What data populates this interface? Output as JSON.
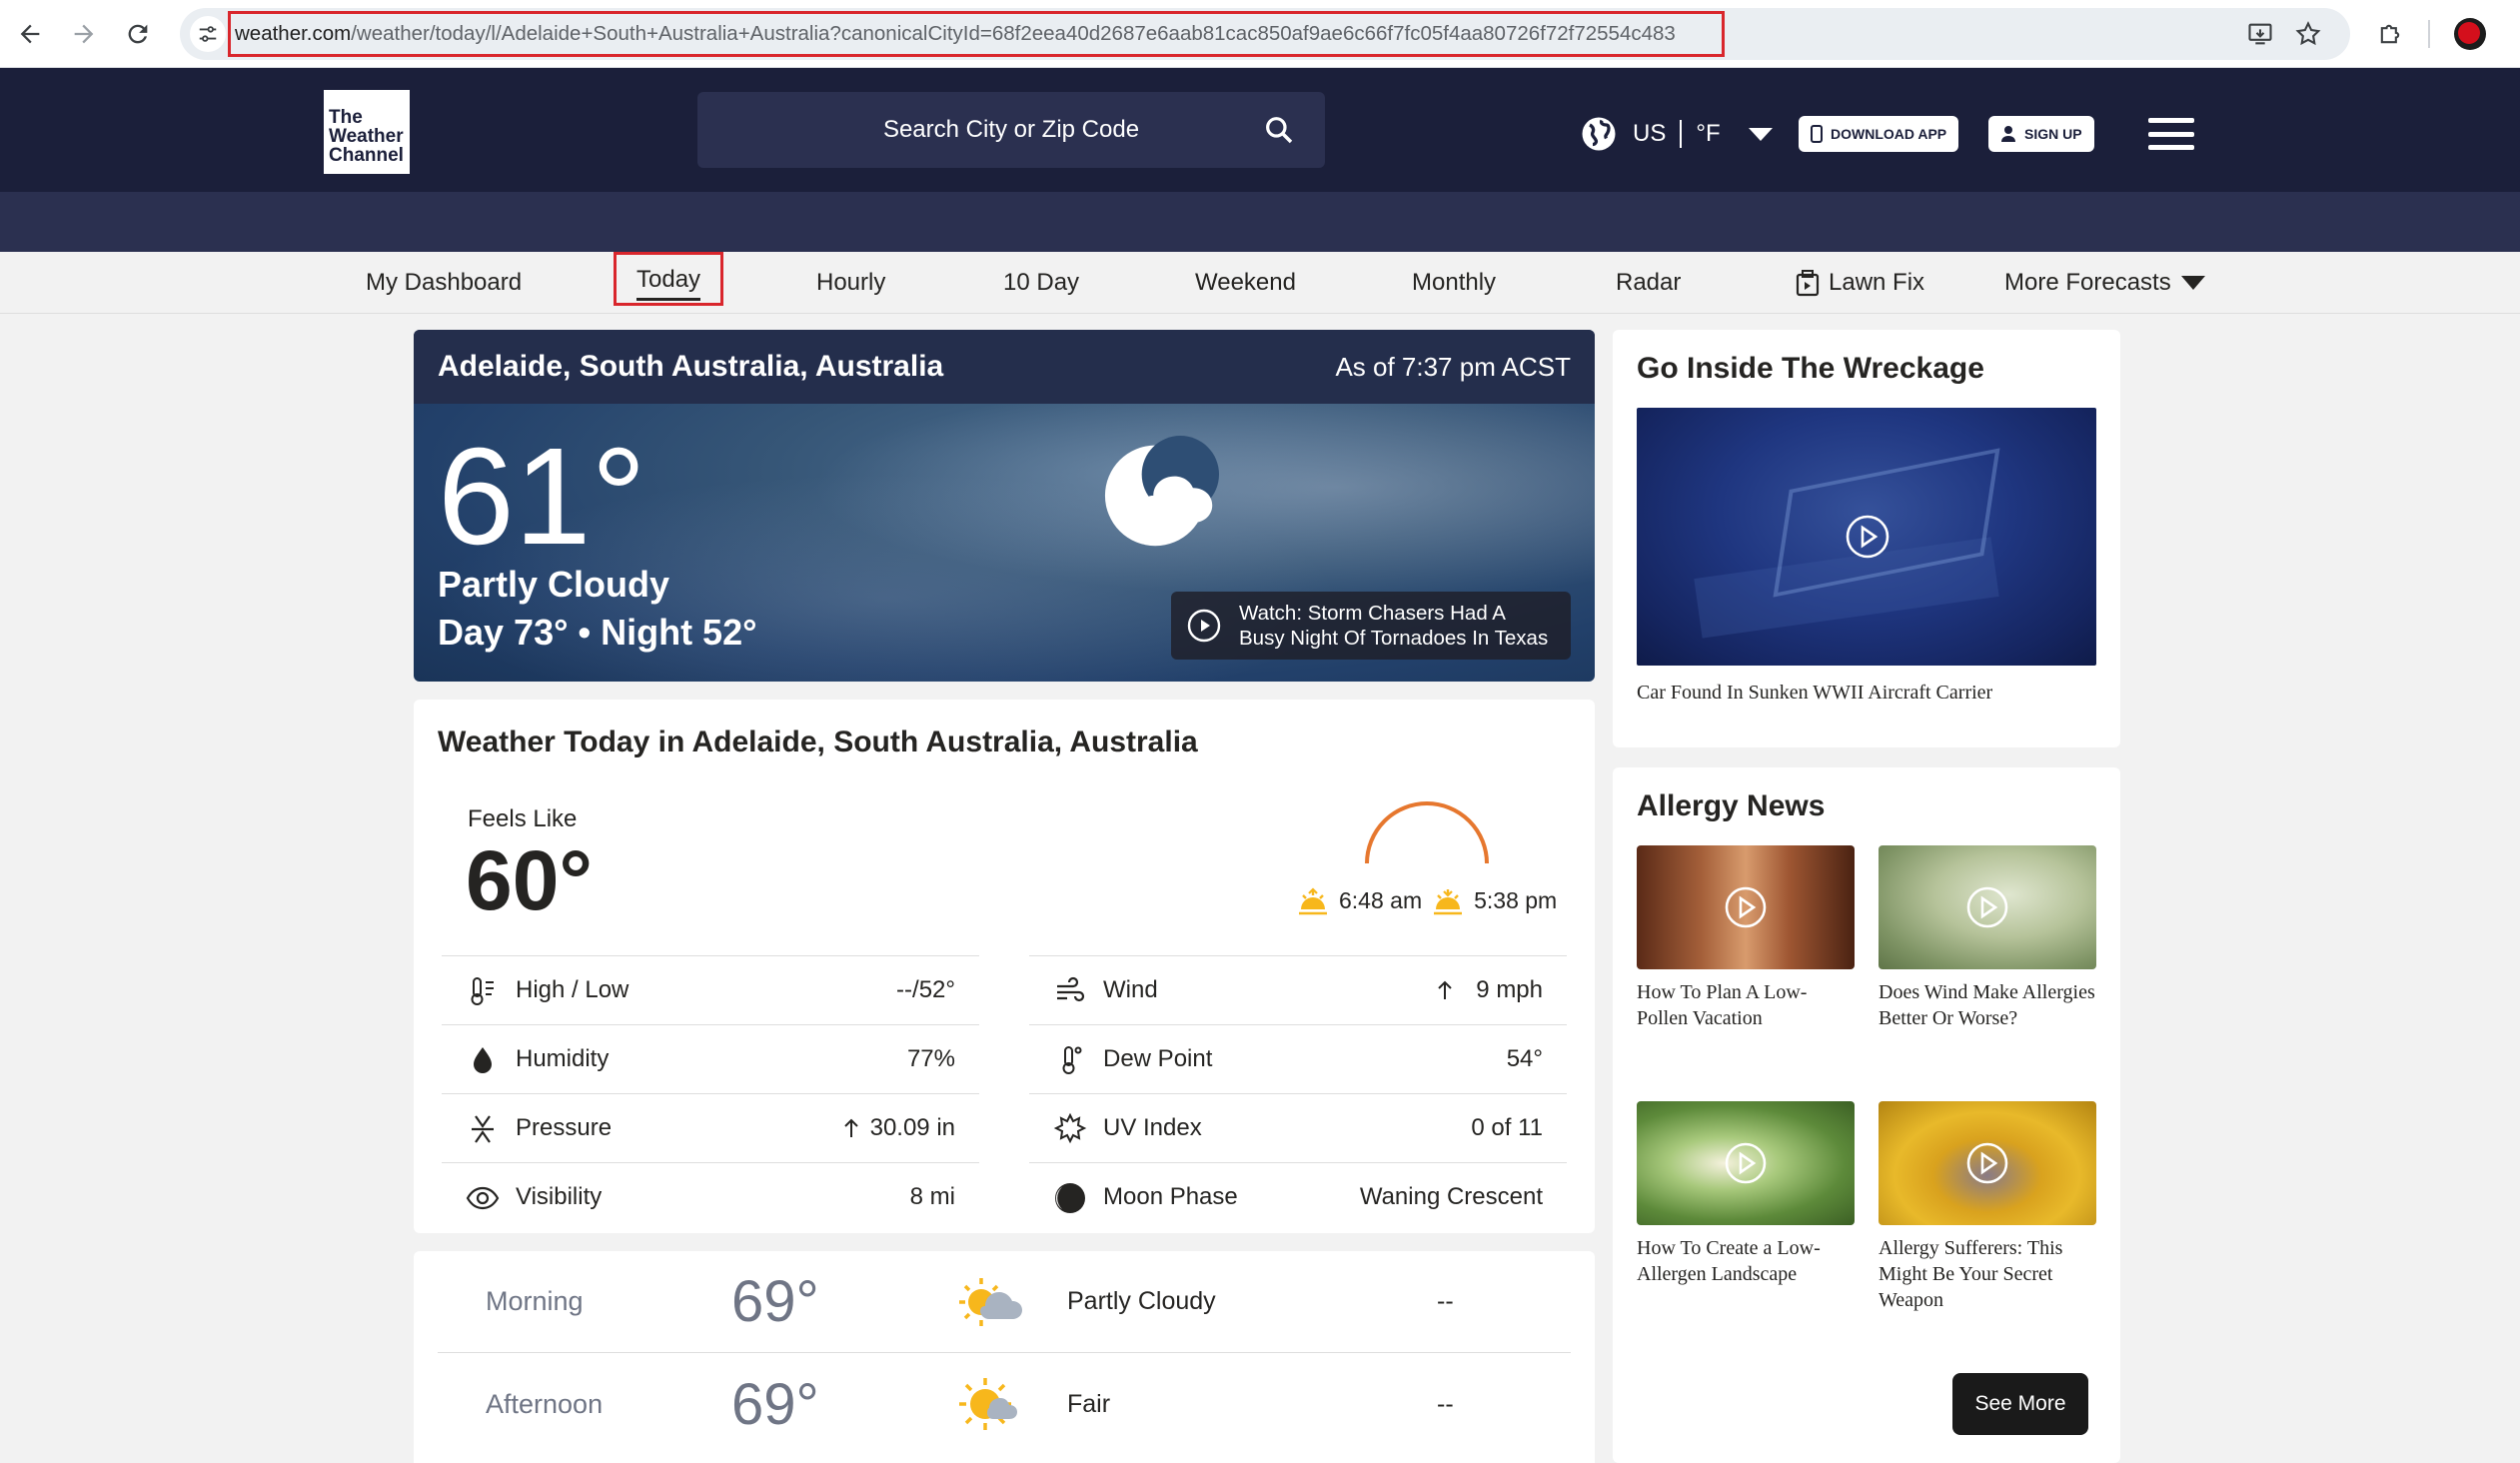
{
  "browser": {
    "url_host": "weather.com",
    "url_path": "/weather/today/l/Adelaide+South+Australia+Australia?canonicalCityId=68f2eea40d2687e6aab81cac850af9ae6c66f7fc05f4aa80726f72f72554c483"
  },
  "header": {
    "logo_line1": "The",
    "logo_line2": "Weather",
    "logo_line3": "Channel",
    "search_placeholder": "Search City or Zip Code",
    "locale_country": "US",
    "locale_unit": "°F",
    "download_app": "DOWNLOAD APP",
    "sign_up": "SIGN UP"
  },
  "subnav": {
    "items": [
      "My Dashboard",
      "Today",
      "Hourly",
      "10 Day",
      "Weekend",
      "Monthly",
      "Radar",
      "Lawn Fix",
      "More Forecasts"
    ]
  },
  "current": {
    "location": "Adelaide, South Australia, Australia",
    "as_of": "As of 7:37 pm ACST",
    "temp": "61°",
    "phrase": "Partly Cloudy",
    "day_night": "Day 73° • Night 52°",
    "video_title": "Watch: Storm Chasers Had A Busy Night Of Tornadoes In Texas",
    "icon": "night-partly-cloudy-icon"
  },
  "today": {
    "title": "Weather Today in Adelaide, South Australia, Australia",
    "feels_like_label": "Feels Like",
    "feels_like_value": "60°",
    "sunrise": "6:48 am",
    "sunset": "5:38 pm",
    "left": [
      {
        "label": "High / Low",
        "value": "--/52°",
        "icon": "thermometer-icon"
      },
      {
        "label": "Humidity",
        "value": "77%",
        "icon": "humidity-drop-icon"
      },
      {
        "label": "Pressure",
        "value": "30.09 in",
        "icon": "pressure-icon"
      },
      {
        "label": "Visibility",
        "value": "8 mi",
        "icon": "visibility-eye-icon"
      }
    ],
    "right": [
      {
        "label": "Wind",
        "value": "9 mph",
        "icon": "wind-icon"
      },
      {
        "label": "Dew Point",
        "value": "54°",
        "icon": "dew-point-icon"
      },
      {
        "label": "UV Index",
        "value": "0 of 11",
        "icon": "uv-sun-icon"
      },
      {
        "label": "Moon Phase",
        "value": "Waning Crescent",
        "icon": "moon-phase-icon"
      }
    ]
  },
  "dayparts": [
    {
      "name": "Morning",
      "temp": "69°",
      "phrase": "Partly Cloudy",
      "precip": "--",
      "icon": "partly-cloudy-day-icon"
    },
    {
      "name": "Afternoon",
      "temp": "69°",
      "phrase": "Fair",
      "precip": "--",
      "icon": "fair-day-icon"
    }
  ],
  "sidebar": {
    "wreck_title": "Go Inside The Wreckage",
    "wreck_caption": "Car Found In Sunken WWII Aircraft Carrier",
    "allergy_title": "Allergy News",
    "allergy_items": [
      {
        "caption": "How To Plan A Low-Pollen Vacation"
      },
      {
        "caption": "Does Wind Make Allergies Better Or Worse?"
      },
      {
        "caption": "How To Create a Low-Allergen Landscape"
      },
      {
        "caption": "Allergy Sufferers: This Might Be Your Secret Weapon"
      }
    ],
    "see_more": "See More"
  },
  "colors": {
    "header_bg": "#1b1f3a",
    "highlight_red": "#d9262c",
    "sun_orange": "#e6772e",
    "sun_yellow": "#f7b71c"
  }
}
